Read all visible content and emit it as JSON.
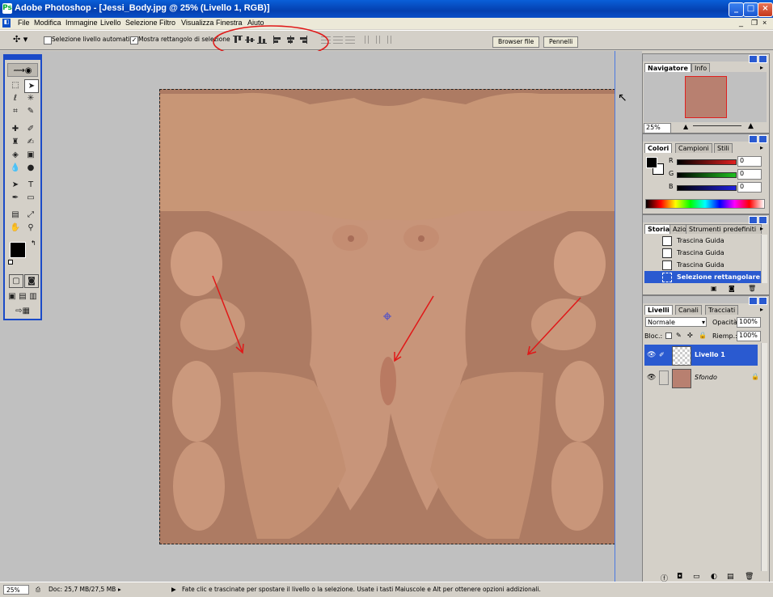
{
  "window": {
    "title": "Adobe Photoshop - [Jessi_Body.jpg @ 25% (Livello 1, RGB)]",
    "buttons": [
      "_",
      "□",
      "×"
    ]
  },
  "menu": [
    "File",
    "Modifica",
    "Immagine",
    "Livello",
    "Selezione",
    "Filtro",
    "Visualizza",
    "Finestra",
    "Aiuto"
  ],
  "options_bar": {
    "auto_select_label": "Selezione livello automatica",
    "show_bounding_label": "Mostra rettangolo di selezione",
    "show_bounding_checked": "✓",
    "tab_file_browser": "Browser file",
    "tab_brushes": "Pennelli"
  },
  "navigator": {
    "tabs": [
      "Navigatore",
      "Info"
    ],
    "zoom": "25%"
  },
  "color": {
    "tabs": [
      "Colori",
      "Campioni",
      "Stili"
    ],
    "r_label": "R",
    "g_label": "G",
    "b_label": "B",
    "r_value": "0",
    "g_value": "0",
    "b_value": "0",
    "colors": {
      "r": "#e02020",
      "g": "#20c020",
      "b": "#2020e0"
    }
  },
  "history": {
    "tabs": [
      "Storia",
      "Azioni",
      "Strumenti predefiniti"
    ],
    "items": [
      "Trascina Guida",
      "Trascina Guida",
      "Trascina Guida",
      "Selezione rettangolare"
    ]
  },
  "layers": {
    "tabs": [
      "Livelli",
      "Canali",
      "Tracciati"
    ],
    "blend_mode": "Normale",
    "opacity_label": "Opacità:",
    "opacity": "100%",
    "lock_label": "Bloc.:",
    "fill_label": "Riemp.:",
    "fill": "100%",
    "items": [
      {
        "name": "Livello 1",
        "selected": true
      },
      {
        "name": "Sfondo",
        "locked": true
      }
    ]
  },
  "status": {
    "zoom": "25%",
    "doc": "Doc: 25,7 MB/27,5 MB",
    "hint": "Fate clic e trascinate per spostare il livello o la selezione.  Usate i tasti Maiuscole e Alt per ottenere opzioni addizionali."
  }
}
